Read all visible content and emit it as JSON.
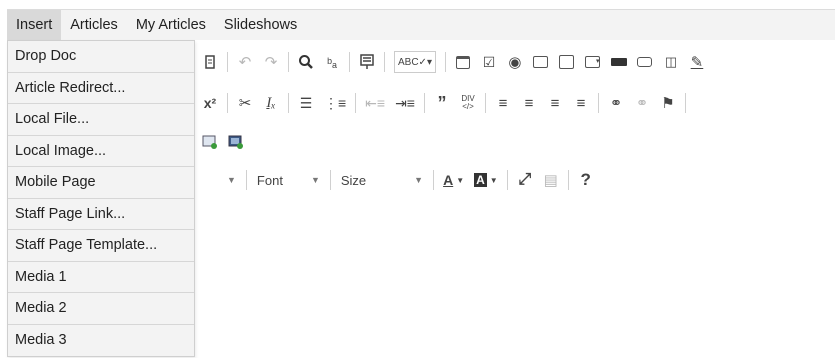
{
  "menubar": {
    "items": [
      {
        "label": "Insert",
        "active": true
      },
      {
        "label": "Articles"
      },
      {
        "label": "My Articles"
      },
      {
        "label": "Slideshows"
      }
    ]
  },
  "dropdown": {
    "items": [
      "Drop Doc",
      "Article Redirect...",
      "Local File...",
      "Local Image...",
      "Mobile Page",
      "Staff Page Link...",
      "Staff Page Template...",
      "Media 1",
      "Media 2",
      "Media 3"
    ]
  },
  "toolbar": {
    "row1_icons": [
      "paste-text-icon",
      "undo-icon",
      "redo-icon",
      "find-icon",
      "replace-icon",
      "select-all-icon",
      "spellcheck-icon",
      "form-icon",
      "checkbox-icon",
      "radio-icon",
      "text-field-icon",
      "textarea-icon",
      "select-field-icon",
      "button-icon",
      "image-button-icon",
      "hidden-field-icon",
      "highlight-icon"
    ],
    "row2_icons": [
      "superscript-icon",
      "copy-format-icon",
      "remove-format-icon",
      "numbered-list-icon",
      "bullet-list-icon",
      "decrease-indent-icon",
      "increase-indent-icon",
      "blockquote-icon",
      "create-div-icon",
      "align-left-icon",
      "align-center-icon",
      "align-right-icon",
      "justify-icon",
      "link-icon",
      "unlink-icon",
      "anchor-icon"
    ],
    "row3_icons": [
      "insert-image-icon",
      "insert-image-2-icon"
    ],
    "font_label": "Font",
    "size_label": "Size",
    "help_label": "?"
  }
}
